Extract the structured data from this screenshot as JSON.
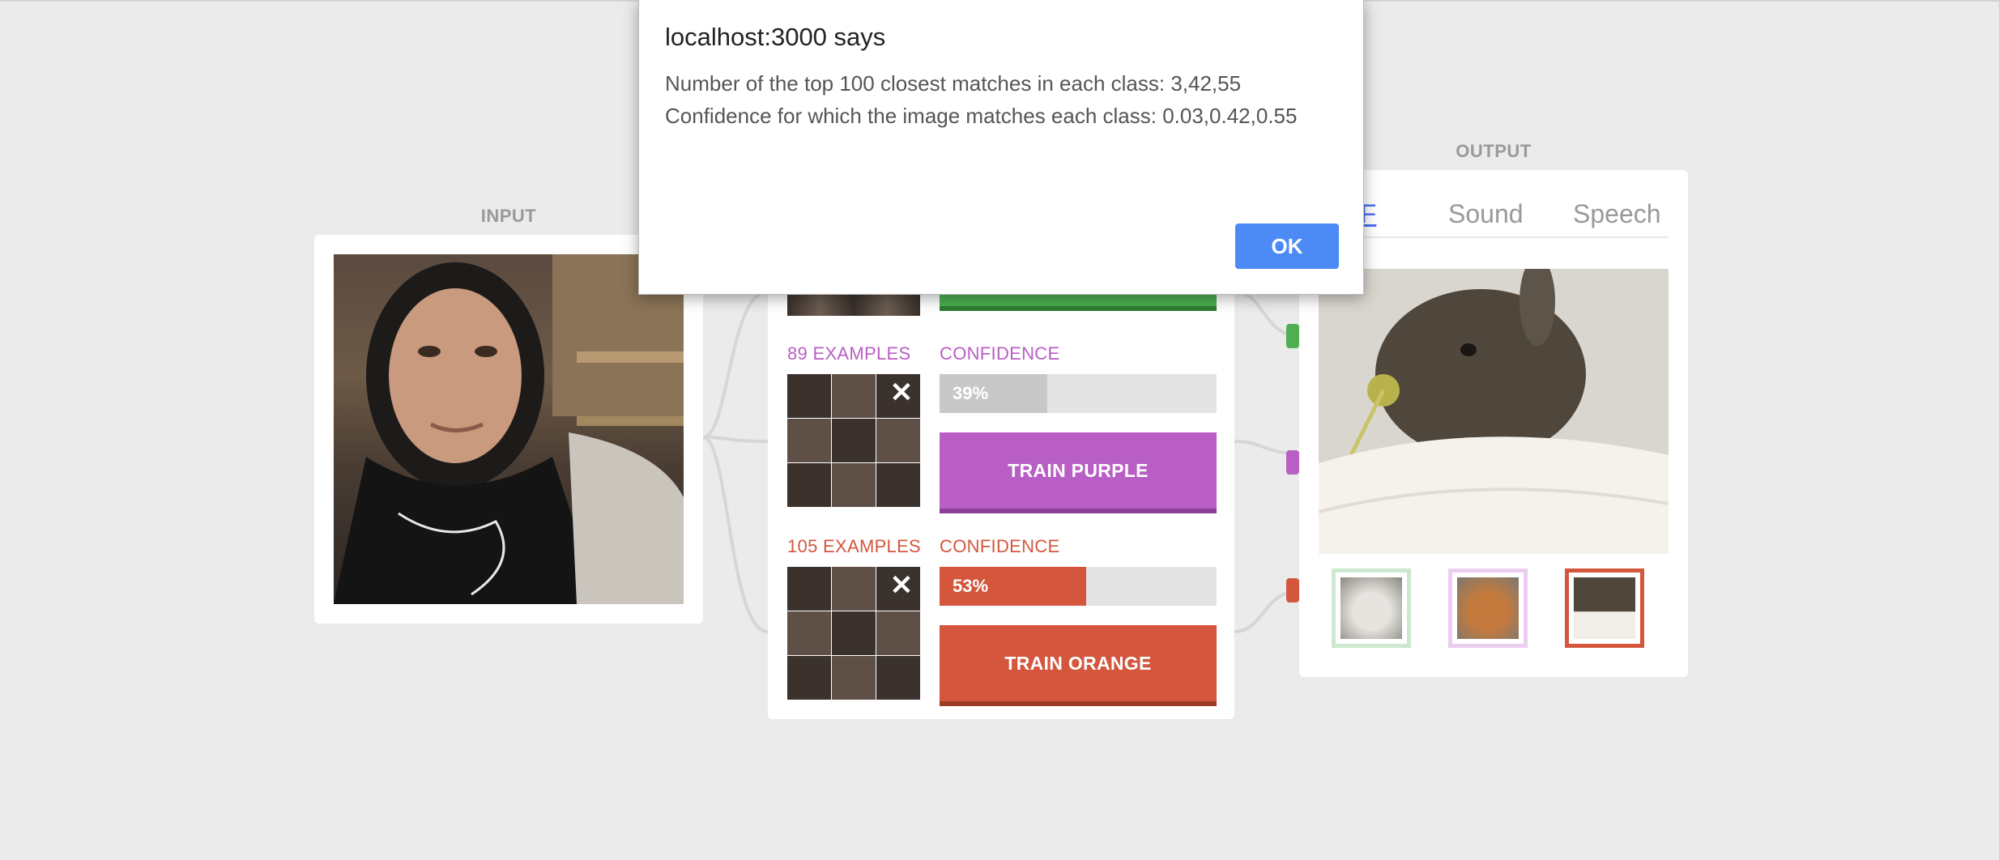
{
  "sections": {
    "input_label": "INPUT",
    "output_label": "OUTPUT"
  },
  "classes": [
    {
      "color": "#4caf50",
      "examples_label": "",
      "confidence_label": "",
      "confidence_value": "",
      "confidence_fraction": 0,
      "train_label": ""
    },
    {
      "color": "#b95ec4",
      "examples_label": "89 EXAMPLES",
      "confidence_label": "CONFIDENCE",
      "confidence_value": "39%",
      "confidence_fraction": 0.39,
      "train_label": "TRAIN PURPLE"
    },
    {
      "color": "#d3563d",
      "examples_label": "105 EXAMPLES",
      "confidence_label": "CONFIDENCE",
      "confidence_value": "53%",
      "confidence_fraction": 0.53,
      "train_label": "TRAIN ORANGE"
    }
  ],
  "output": {
    "tabs": [
      {
        "label": "GIF",
        "active": true
      },
      {
        "label": "Sound",
        "active": false
      },
      {
        "label": "Speech",
        "active": false
      }
    ],
    "thumbnails": [
      {
        "name": "white-bunny",
        "border": "#cde8cf"
      },
      {
        "name": "orange-bunny",
        "border": "#eccdf0"
      },
      {
        "name": "gray-bunny",
        "border": "#d3563d"
      }
    ]
  },
  "dialog": {
    "title": "localhost:3000 says",
    "line1": "Number of the top 100 closest matches in each class: 3,42,55",
    "line2": "Confidence for which the image matches each class: 0.03,0.42,0.55",
    "ok_label": "OK"
  }
}
